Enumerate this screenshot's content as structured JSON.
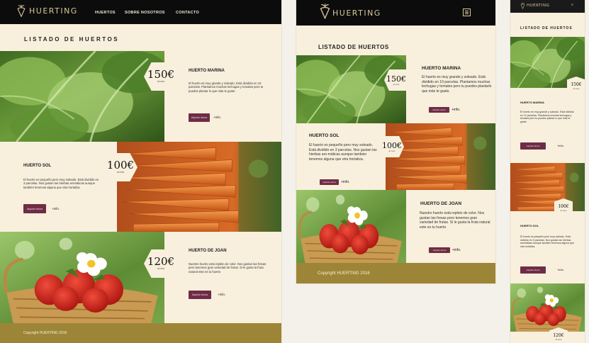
{
  "brand": {
    "name": "HUERTING",
    "accent": "#6e2d45",
    "footer_color": "#9d8538",
    "header_color": "#0c0c0c",
    "background": "#f8efdd"
  },
  "nav": {
    "items": [
      "HUERTOS",
      "SOBRE NOSOTROS",
      "CONTACTO"
    ]
  },
  "page": {
    "title": "LISTADO DE HUERTOS",
    "footer": "Copyright HUERTING 2016"
  },
  "orchards": [
    {
      "name": "HUERTO MARINA",
      "price": "150€",
      "unit": "al mes",
      "desc_desktop": "El huerto es muy grande y soleado. Está dividido en 10 parcelas. Plantamos muchas lechugas y tomates pero tu puedes plantar lo que más te guste.",
      "desc_tablet": "El huerto es muy grande y soleado. Está dividido en 10 parcelas. Plantamos muchas lechugas y tomates pero tu puedes plantarlo que más te guste.",
      "desc_mobile": "El huerto es muy grande y soleado. Está dividido en 10 parcelas. Plantamos muchas lechugas y tomates pero tu puedes plantar lo que más te guste."
    },
    {
      "name": "HUERTO SOL",
      "price": "100€",
      "unit": "al mes",
      "desc_desktop": "El huerto es pequeño pero muy soleado. Está dividido en 3 parcelas. Nos gustan las hierbas aromáticas aunque también tenemos alguna que otra hortaliza.",
      "desc_tablet": "El huerto es pequeño pero muy soleado. Está dividido en 3 parcelas. Nos gustan las hierbas aro-máticas aunque tambien tenemos alguna que otra hortaliza.",
      "desc_mobile": "El huerto es pequeño pero muy soleado. Está dividido en 3 parcelas. Nos gustan las hierbas aromáticas aunque tambien tenemos alguna que otra hortaliza."
    },
    {
      "name": "HUERTO DE JOAN",
      "price": "120€",
      "unit": "al mes",
      "desc_desktop": "Nuestro huerto está repleto de color. Nos gustan las fresas pero tenemos gran variedad de frutas. Si le gusta la fruta natural este es tu huerto",
      "desc_tablet": "Nuestro huerto está repleto de color. Nos gustan las fresas pero tenemos gran variedad de frutas. Si le gusta la fruta natural este es tu huerto",
      "desc_mobile": ""
    }
  ],
  "actions": {
    "reserve": "Alquilar ahora",
    "info": "+info."
  }
}
